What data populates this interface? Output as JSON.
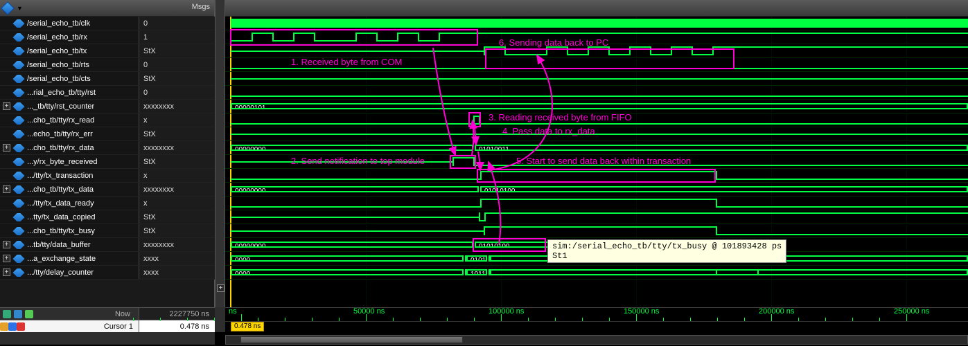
{
  "header": {
    "msgs_label": "Msgs"
  },
  "signals": [
    {
      "name": "/serial_echo_tb/clk",
      "value": "0",
      "expand": null
    },
    {
      "name": "/serial_echo_tb/rx",
      "value": "1",
      "expand": null
    },
    {
      "name": "/serial_echo_tb/tx",
      "value": "StX",
      "expand": null
    },
    {
      "name": "/serial_echo_tb/rts",
      "value": "0",
      "expand": null
    },
    {
      "name": "/serial_echo_tb/cts",
      "value": "StX",
      "expand": null
    },
    {
      "name": "...rial_echo_tb/tty/rst",
      "value": "0",
      "expand": null
    },
    {
      "name": "..._tb/tty/rst_counter",
      "value": "xxxxxxxx",
      "expand": "+"
    },
    {
      "name": "...cho_tb/tty/rx_read",
      "value": "x",
      "expand": null
    },
    {
      "name": "...echo_tb/tty/rx_err",
      "value": "StX",
      "expand": null
    },
    {
      "name": "...cho_tb/tty/rx_data",
      "value": "xxxxxxxx",
      "expand": "+"
    },
    {
      "name": "...y/rx_byte_received",
      "value": "StX",
      "expand": null
    },
    {
      "name": ".../tty/tx_transaction",
      "value": "x",
      "expand": null
    },
    {
      "name": "...cho_tb/tty/tx_data",
      "value": "xxxxxxxx",
      "expand": "+"
    },
    {
      "name": ".../tty/tx_data_ready",
      "value": "x",
      "expand": null
    },
    {
      "name": "...tty/tx_data_copied",
      "value": "StX",
      "expand": null
    },
    {
      "name": "...cho_tb/tty/tx_busy",
      "value": "StX",
      "expand": null
    },
    {
      "name": "...tb/tty/data_buffer",
      "value": "xxxxxxxx",
      "expand": "+"
    },
    {
      "name": "...a_exchange_state",
      "value": "xxxx",
      "expand": "+"
    },
    {
      "name": ".../tty/delay_counter",
      "value": "xxxx",
      "expand": "+"
    }
  ],
  "bus_values": {
    "rst_counter_initial": "00000101",
    "rx_data_initial": "00000000",
    "rx_data_after": "01010011",
    "tx_data_initial": "00000000",
    "tx_data_after": "01010100",
    "data_buffer_initial": "00000000",
    "data_buffer_after": "01010100",
    "exchange_initial": "0000",
    "exchange_after": "0101",
    "delay_initial": "0000",
    "delay_after": "1011"
  },
  "annotations": {
    "a1": "1. Received byte from COM",
    "a2": "2. Send notification to top module",
    "a3": "3. Reading received byte from FIFO",
    "a4": "4. Pass data to rx_data",
    "a5": "5. Start to send data back within transaction",
    "a6": "6. Sending data back to PC"
  },
  "tooltip": {
    "line1": "sim:/serial_echo_tb/tty/tx_busy @ 101893428 ps",
    "line2": "St1"
  },
  "time": {
    "now_label": "Now",
    "now_value": "2227750 ns",
    "cursor_label": "Cursor 1",
    "cursor_value": "0.478 ns",
    "cursor_flag": "0.478 ns",
    "ticks": [
      {
        "pos": 15,
        "label": "ns",
        "major": false
      },
      {
        "pos": 195,
        "label": "50000 ns",
        "major": true
      },
      {
        "pos": 390,
        "label": "100000 ns",
        "major": true
      },
      {
        "pos": 585,
        "label": "150000 ns",
        "major": true
      },
      {
        "pos": 780,
        "label": "200000 ns",
        "major": true
      },
      {
        "pos": 975,
        "label": "250000 ns",
        "major": true
      }
    ]
  },
  "colors": {
    "wave": "#00ff41",
    "annot": "#ff00d4",
    "cursor": "#ffd600"
  }
}
